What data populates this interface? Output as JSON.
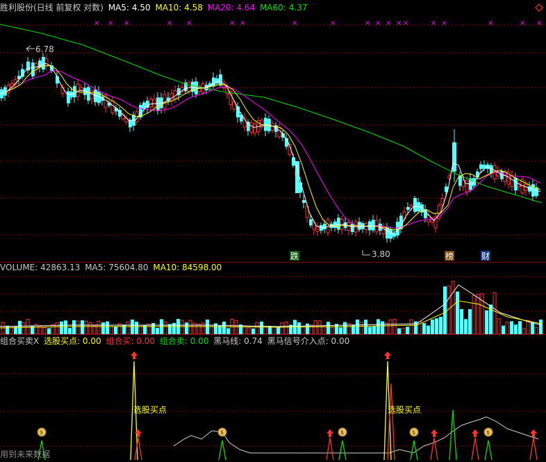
{
  "main": {
    "title": "胜利股份(日线 前复权 对数)",
    "ma5_label": "MA5: 4.50",
    "ma10_label": "MA10: 4.58",
    "ma20_label": "MA20: 4.64",
    "ma60_label": "MA60: 4.37",
    "high_marker": "6.78",
    "low_marker": "3.80",
    "tag_die": "跌",
    "tag_bang": "榜",
    "tag_cai": "财",
    "x_marker": "×"
  },
  "volume": {
    "label": "VOLUME: 42863.13",
    "ma5_label": "MA5: 75604.80",
    "ma10_label": "MA10: 84598.00"
  },
  "indicator": {
    "name": "组合买卖X",
    "buy_label": "选股买点: 0.00",
    "combo_buy_label": "组合买: 0.00",
    "combo_sell_label": "组合卖: 0.00",
    "heima_label": "黑马线: 0.74",
    "heima_signal_label": "黑马信号介入点: 0.00",
    "annotation_1": "选股买点",
    "annotation_2": "选股买点",
    "coin_char": "$"
  },
  "footer": {
    "tip": "用到未来数据"
  },
  "colors": {
    "up": "#ff3232",
    "down": "#54ffff",
    "ma5": "#ffffff",
    "ma10": "#ffff00",
    "ma20": "#ff00ff",
    "ma60": "#00e000",
    "grid": "#8b0000",
    "title": "#c8c8c8"
  }
}
